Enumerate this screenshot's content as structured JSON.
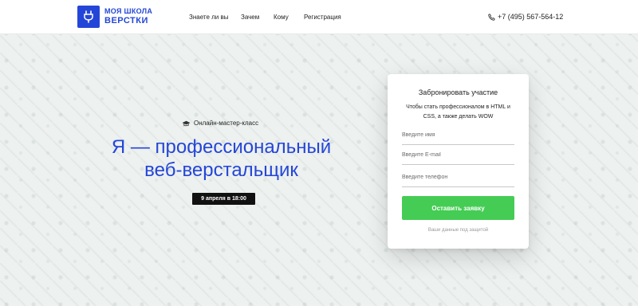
{
  "brand": {
    "line1": "МОЯ ШКОЛА",
    "line2": "ВЕРСТКИ",
    "icon": "plug-icon",
    "color": "#2446d8"
  },
  "nav": {
    "items": [
      "Знаете ли вы",
      "Зачем",
      "Кому",
      "Регистрация"
    ]
  },
  "contact": {
    "phone": "+7 (495) 567-564-12",
    "icon": "phone-icon"
  },
  "hero": {
    "subtitle": "Онлайн-мастер-класс",
    "subtitle_icon": "graduation-cap-icon",
    "title_line1": "Я — профессиональный",
    "title_line2": "веб-верстальщик",
    "date": "9 апреля в 18:00"
  },
  "form": {
    "title": "Забронировать участие",
    "description": "Чтобы стать профессионалом в HTML и CSS, а также делать WOW",
    "name_placeholder": "Введите имя",
    "email_placeholder": "Введите E-mail",
    "phone_placeholder": "Введите телефон",
    "submit_label": "Оставить заявку",
    "privacy_note": "Ваши данные под защитой",
    "submit_color": "#45cc54"
  }
}
